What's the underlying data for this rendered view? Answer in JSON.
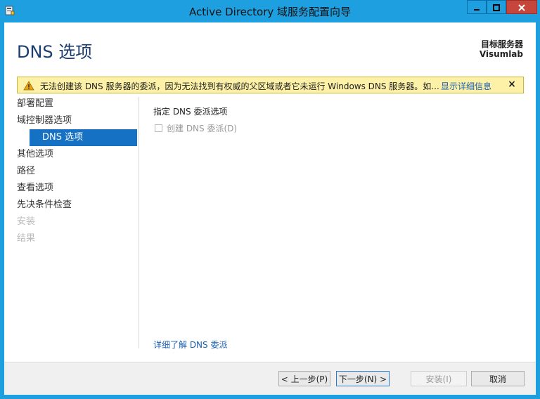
{
  "window": {
    "title": "Active Directory 域服务配置向导",
    "icons": {
      "app": "server-icon",
      "minimize": "minimize-icon",
      "maximize": "maximize-icon",
      "close": "close-icon"
    }
  },
  "header": {
    "page_title": "DNS 选项",
    "target_label": "目标服务器",
    "target_name": "Visumlab"
  },
  "warning": {
    "text": "无法创建该 DNS 服务器的委派，因为无法找到有权威的父区域或者它未运行 Windows DNS 服务器。如...",
    "link": "显示详细信息",
    "close_glyph": "×",
    "colors": {
      "background": "#fdf1a7",
      "border": "#c9b53a",
      "icon": "#e8a319"
    }
  },
  "nav": {
    "items": [
      {
        "label": "部署配置",
        "state": "normal"
      },
      {
        "label": "域控制器选项",
        "state": "normal"
      },
      {
        "label": "DNS 选项",
        "state": "selected"
      },
      {
        "label": "其他选项",
        "state": "normal"
      },
      {
        "label": "路径",
        "state": "normal"
      },
      {
        "label": "查看选项",
        "state": "normal"
      },
      {
        "label": "先决条件检查",
        "state": "normal"
      },
      {
        "label": "安装",
        "state": "disabled"
      },
      {
        "label": "结果",
        "state": "disabled"
      }
    ],
    "selected_color": "#1471c4"
  },
  "content": {
    "section_label": "指定 DNS 委派选项",
    "checkbox_label": "创建 DNS 委派(D)",
    "learn_link": "详细了解 DNS 委派"
  },
  "footer": {
    "prev": "< 上一步(P)",
    "next": "下一步(N) >",
    "install": "安装(I)",
    "cancel": "取消"
  },
  "theme": {
    "titlebar": "#1e9fe0",
    "close_button": "#c7463c",
    "link": "#1a5fb4"
  }
}
